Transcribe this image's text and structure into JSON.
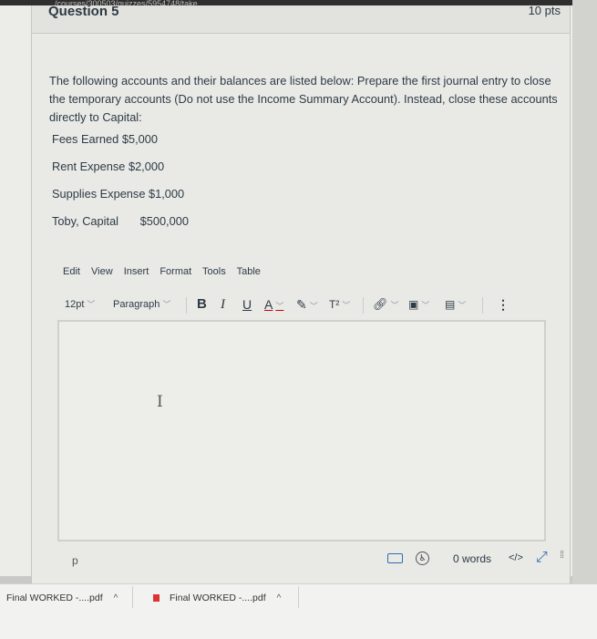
{
  "browser": {
    "url_fragment": "/courses/300503/quizzes/5954748/take"
  },
  "question": {
    "title": "Question 5",
    "points": "10 pts",
    "prompt": "The following accounts and their balances are listed below: Prepare the first journal entry to close the temporary accounts (Do not use the Income Summary Account). Instead, close these accounts directly to Capital:",
    "accounts": [
      {
        "name": "Fees Earned",
        "amount": "$5,000"
      },
      {
        "name": "Rent Expense",
        "amount": "$2,000"
      },
      {
        "name": "Supplies Expense",
        "amount": "$1,000"
      },
      {
        "name": "Toby, Capital",
        "amount": "$500,000"
      }
    ]
  },
  "editor": {
    "menu": [
      "Edit",
      "View",
      "Insert",
      "Format",
      "Tools",
      "Table"
    ],
    "font_size": "12pt",
    "block_format": "Paragraph",
    "bold": "B",
    "italic": "I",
    "underline": "U",
    "text_color": "A",
    "superscript": "T²",
    "more": "⋮",
    "cursor": "I",
    "path": "p",
    "word_count": "0 words",
    "html_toggle": "</>"
  },
  "downloads": [
    {
      "name": "Final WORKED -....pdf"
    },
    {
      "name": "Final WORKED -....pdf"
    }
  ],
  "colors": {
    "text": "#2d3b45",
    "accent": "#2d6fb3",
    "page": "#ecece9"
  }
}
